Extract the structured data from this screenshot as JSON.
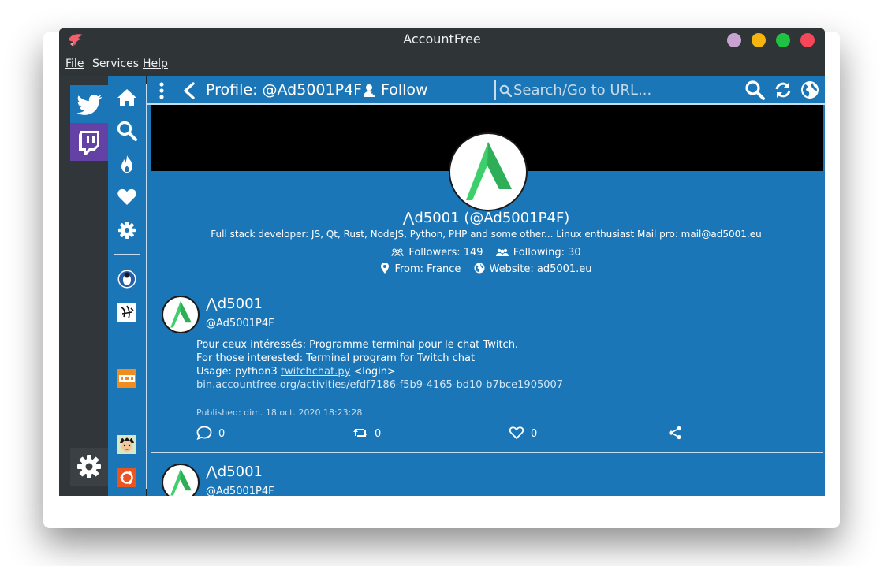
{
  "window": {
    "title": "AccountFree",
    "controls": {
      "purple": "#c8a3d2",
      "yellow": "#f5b50f",
      "green": "#1fc341",
      "red": "#f5475a"
    }
  },
  "menu": [
    {
      "label": "File"
    },
    {
      "label": "Services"
    },
    {
      "label": "Help"
    }
  ],
  "services": [
    {
      "name": "twitter-icon",
      "color": "#1b76b7"
    },
    {
      "name": "twitch-icon",
      "color": "#6441a5"
    }
  ],
  "header": {
    "title": "Profile: @Ad5001P4F",
    "follow_label": "Follow",
    "search_placeholder": "Search/Go to URL..."
  },
  "profile": {
    "name": "⋀d5001 (@Ad5001P4F)",
    "bio": "Full stack developer: JS, Qt, Rust, NodeJS, Python, PHP and some other... Linux enthusiast Mail pro: mail@ad5001.eu",
    "followers": "Followers: 149",
    "following": "Following: 30",
    "location": "From: France",
    "website": "Website: ad5001.eu"
  },
  "tweets": [
    {
      "name": "⋀d5001",
      "handle": "@Ad5001P4F",
      "line1": "Pour ceux intéressés: Programme terminal pour le chat Twitch.",
      "line2": "For those interested: Terminal program for Twitch chat",
      "line3_prefix": "Usage: python3 ",
      "line3_link": "twitchchat.py",
      "line3_suffix": " <login>",
      "link": "bin.accountfree.org/activities/efdf7186-f5b9-4165-bd10-b7bce1905007",
      "published": "Published: dim. 18 oct. 2020 18:23:28",
      "replies": "0",
      "retweets": "0",
      "likes": "0"
    },
    {
      "name": "⋀d5001",
      "handle": "@Ad5001P4F"
    }
  ],
  "colors": {
    "accent": "#1b76b7",
    "separator": "#c7dced",
    "logo_green": "#3ecf6c"
  }
}
